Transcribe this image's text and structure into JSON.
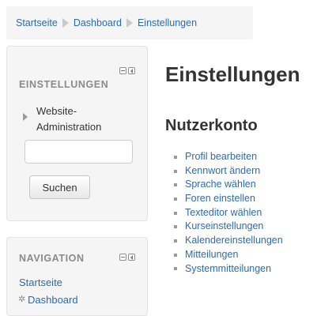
{
  "breadcrumb": {
    "items": [
      "Startseite",
      "Dashboard",
      "Einstellungen"
    ]
  },
  "settings_block": {
    "title": "EINSTELLUNGEN",
    "tree_item": "Website-Administration",
    "search": {
      "value": "",
      "placeholder": ""
    },
    "search_button": "Suchen"
  },
  "nav_block": {
    "title": "NAVIGATION",
    "items": [
      "Startseite",
      "Dashboard"
    ]
  },
  "main": {
    "title": "Einstellungen",
    "section_title": "Nutzerkonto",
    "links": [
      "Profil bearbeiten",
      "Kennwort ändern",
      "Sprache wählen",
      "Foren einstellen",
      "Texteditor wählen",
      "Kurseinstellungen",
      "Kalendereinstellungen",
      "Mitteilungen",
      "Systemmitteilungen"
    ]
  },
  "colors": {
    "link": "#2a6cb0",
    "block_bg": "#f5f5f5",
    "muted": "#8a8a8a"
  }
}
